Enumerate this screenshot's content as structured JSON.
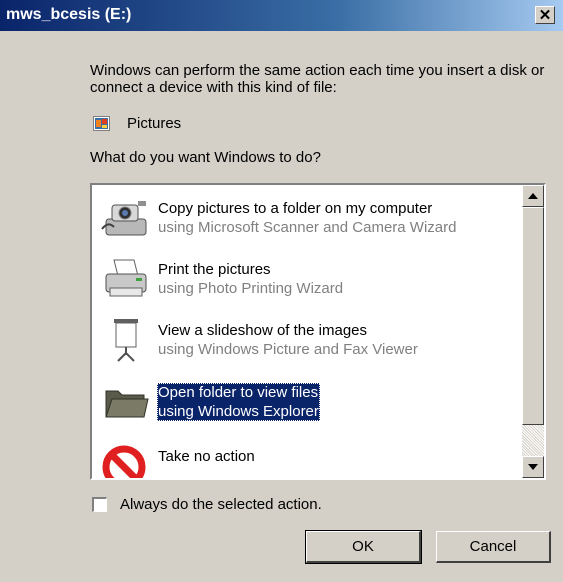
{
  "window": {
    "title": "mws_bcesis (E:)",
    "close_glyph": "✕"
  },
  "description": "Windows can perform the same action each time you insert a disk or connect a device with this kind of file:",
  "content_type": {
    "icon": "pictures-icon",
    "label": "Pictures"
  },
  "question": "What do you want Windows to do?",
  "actions": [
    {
      "title": "Copy pictures to a folder on my computer",
      "subtitle": "using Microsoft Scanner and Camera Wizard",
      "icon": "camera-icon",
      "selected": false
    },
    {
      "title": "Print the pictures",
      "subtitle": "using Photo Printing Wizard",
      "icon": "printer-icon",
      "selected": false
    },
    {
      "title": "View a slideshow of the images",
      "subtitle": "using Windows Picture and Fax Viewer",
      "icon": "projector-screen-icon",
      "selected": false
    },
    {
      "title": "Open folder to view files",
      "subtitle": "using Windows Explorer",
      "icon": "folder-icon",
      "selected": true
    },
    {
      "title": "Take no action",
      "subtitle": "",
      "icon": "no-action-icon",
      "selected": false
    }
  ],
  "always_checkbox": {
    "label": "Always do the selected action.",
    "checked": false
  },
  "buttons": {
    "ok": "OK",
    "cancel": "Cancel"
  }
}
